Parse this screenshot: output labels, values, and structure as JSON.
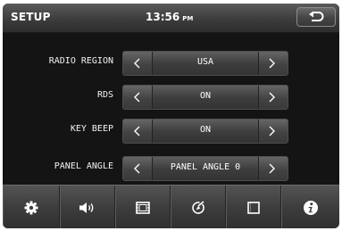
{
  "header": {
    "title": "SETUP",
    "time": "13:56",
    "ampm": "PM",
    "back_icon": "return-arrow-icon"
  },
  "settings": [
    {
      "label": "RADIO REGION",
      "value": "USA"
    },
    {
      "label": "RDS",
      "value": "ON"
    },
    {
      "label": "KEY BEEP",
      "value": "ON"
    },
    {
      "label": "PANEL ANGLE",
      "value": "PANEL ANGLE 0"
    }
  ],
  "nav": [
    {
      "icon": "gear-icon"
    },
    {
      "icon": "speaker-icon"
    },
    {
      "icon": "video-icon"
    },
    {
      "icon": "navigation-icon"
    },
    {
      "icon": "display-icon"
    },
    {
      "icon": "info-icon"
    }
  ],
  "colors": {
    "background": "#131313",
    "bar": "#3c3c3c",
    "text": "#ffffff"
  }
}
